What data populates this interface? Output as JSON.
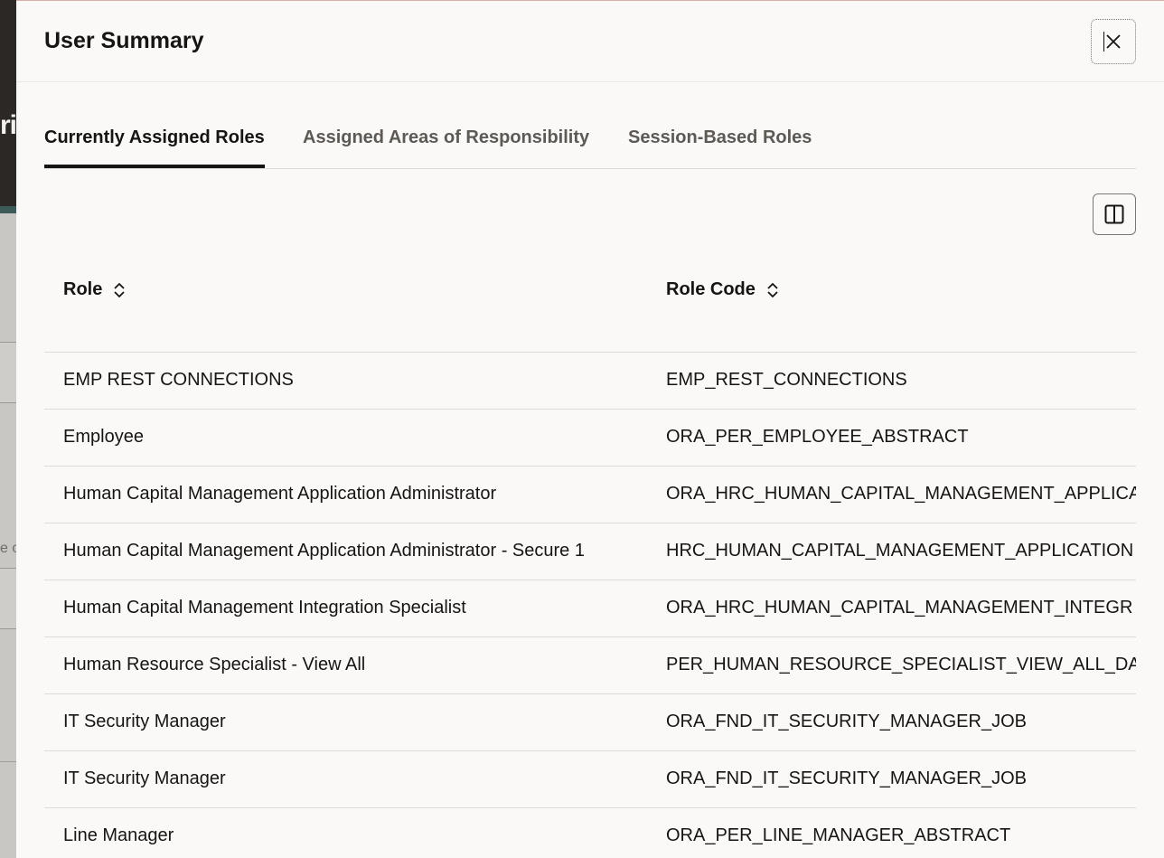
{
  "drawer": {
    "title": "User Summary",
    "close_label": "Close"
  },
  "background": {
    "title_fragment": "ri",
    "text_fragment": "e c"
  },
  "tabs": [
    {
      "label": "Currently Assigned Roles",
      "selected": true
    },
    {
      "label": "Assigned Areas of Responsibility",
      "selected": false
    },
    {
      "label": "Session-Based Roles",
      "selected": false
    }
  ],
  "toolbar": {
    "columns_icon": "columns-icon"
  },
  "table": {
    "columns": [
      "Role",
      "Role Code"
    ],
    "rows": [
      {
        "role": "EMP REST CONNECTIONS",
        "code": "EMP_REST_CONNECTIONS"
      },
      {
        "role": "Employee",
        "code": "ORA_PER_EMPLOYEE_ABSTRACT"
      },
      {
        "role": "Human Capital Management Application Administrator",
        "code": "ORA_HRC_HUMAN_CAPITAL_MANAGEMENT_APPLICA"
      },
      {
        "role": "Human Capital Management Application Administrator - Secure 1",
        "code": "HRC_HUMAN_CAPITAL_MANAGEMENT_APPLICATION"
      },
      {
        "role": "Human Capital Management Integration Specialist",
        "code": "ORA_HRC_HUMAN_CAPITAL_MANAGEMENT_INTEGR"
      },
      {
        "role": "Human Resource Specialist - View All",
        "code": "PER_HUMAN_RESOURCE_SPECIALIST_VIEW_ALL_DAT"
      },
      {
        "role": "IT Security Manager",
        "code": "ORA_FND_IT_SECURITY_MANAGER_JOB"
      },
      {
        "role": "IT Security Manager",
        "code": "ORA_FND_IT_SECURITY_MANAGER_JOB"
      },
      {
        "role": "Line Manager",
        "code": "ORA_PER_LINE_MANAGER_ABSTRACT"
      }
    ]
  },
  "colors": {
    "text": "#161513",
    "muted_tab": "#5d5955",
    "divider": "#dedad6",
    "panel_bg": "#fbf9f8"
  }
}
